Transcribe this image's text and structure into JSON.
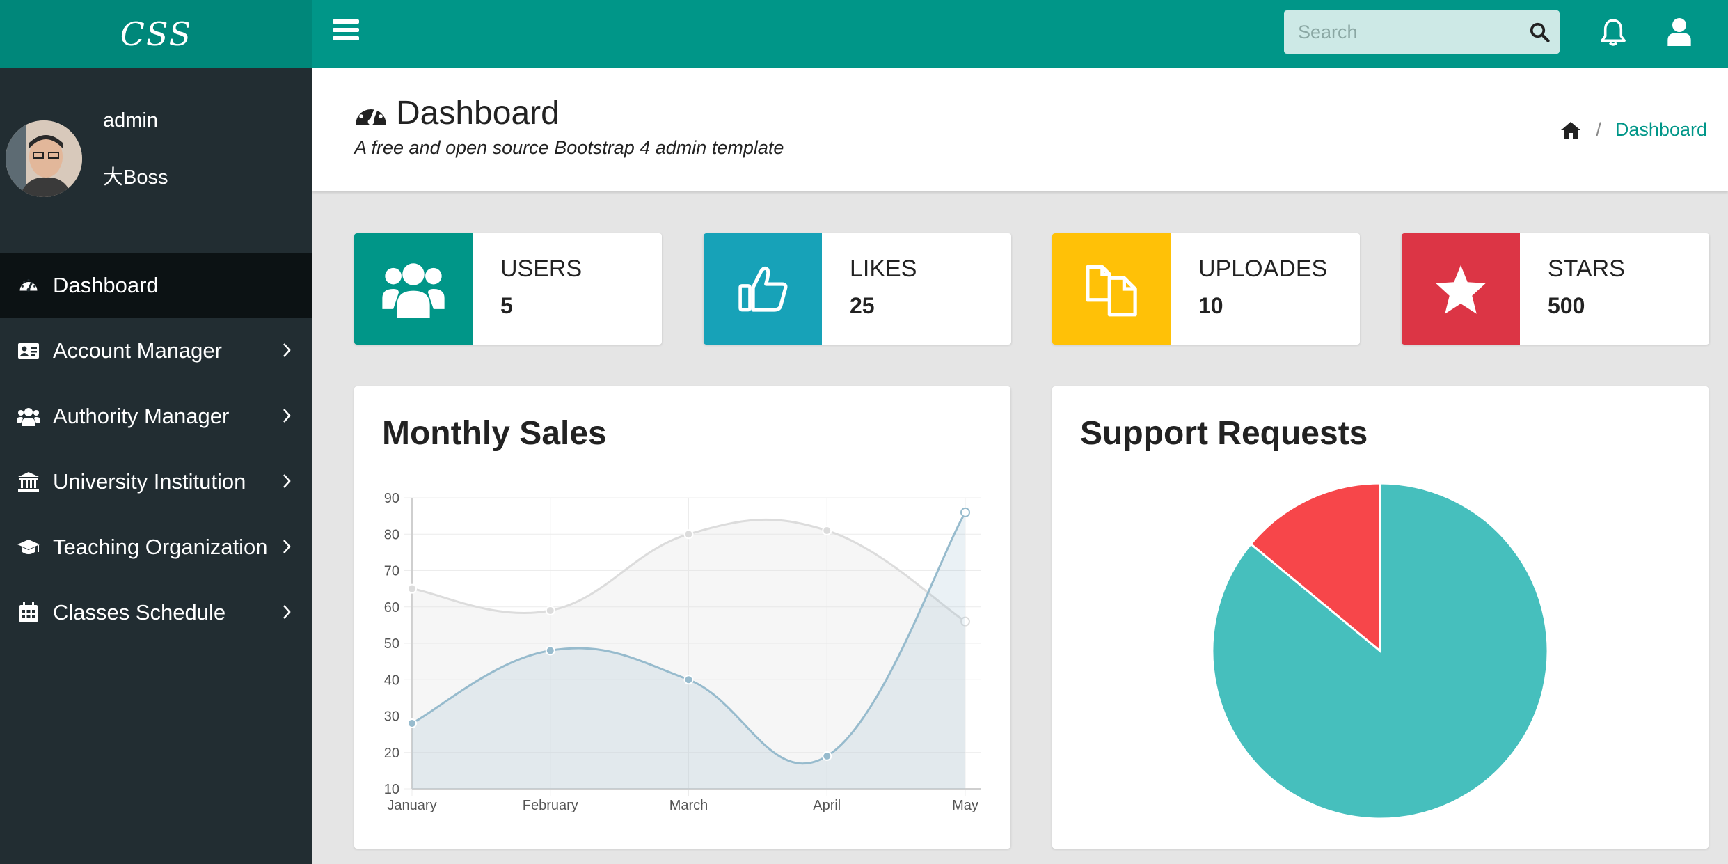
{
  "brand": {
    "logo_text": "CSS"
  },
  "header": {
    "search_placeholder": "Search",
    "search_value": ""
  },
  "user": {
    "name": "admin",
    "role": "大Boss"
  },
  "sidebar": {
    "items": [
      {
        "label": "Dashboard",
        "icon": "dashboard-icon",
        "active": true
      },
      {
        "label": "Account Manager",
        "icon": "id-card-icon"
      },
      {
        "label": "Authority Manager",
        "icon": "users-icon"
      },
      {
        "label": "University Institution",
        "icon": "institution-icon"
      },
      {
        "label": "Teaching Organization",
        "icon": "graduation-cap-icon"
      },
      {
        "label": "Classes Schedule",
        "icon": "calendar-icon"
      }
    ]
  },
  "page": {
    "title": "Dashboard",
    "subtitle": "A free and open source Bootstrap 4 admin template",
    "breadcrumb": [
      "Dashboard"
    ]
  },
  "widgets": [
    {
      "label": "USERS",
      "value": "5",
      "color": "#009688",
      "icon": "users-icon"
    },
    {
      "label": "LIKES",
      "value": "25",
      "color": "#17a2b8",
      "icon": "thumbs-up-icon"
    },
    {
      "label": "UPLOADES",
      "value": "10",
      "color": "#ffc107",
      "icon": "files-icon"
    },
    {
      "label": "STARS",
      "value": "500",
      "color": "#dc3545",
      "icon": "star-icon"
    }
  ],
  "chart_data": [
    {
      "type": "line",
      "title": "Monthly Sales",
      "categories": [
        "January",
        "February",
        "March",
        "April",
        "May"
      ],
      "series": [
        {
          "values": [
            65,
            59,
            80,
            81,
            56
          ],
          "color": "#dcdcdc"
        },
        {
          "values": [
            28,
            48,
            40,
            19,
            86
          ],
          "color": "#97bbcd"
        }
      ],
      "ylim": [
        10,
        90
      ],
      "yticks": [
        10,
        20,
        30,
        40,
        50,
        60,
        70,
        80,
        90
      ],
      "grid": true
    },
    {
      "type": "pie",
      "title": "Support Requests",
      "slices": [
        {
          "value": 86,
          "color": "#46bfbd"
        },
        {
          "value": 14,
          "color": "#f7464a"
        }
      ]
    }
  ]
}
